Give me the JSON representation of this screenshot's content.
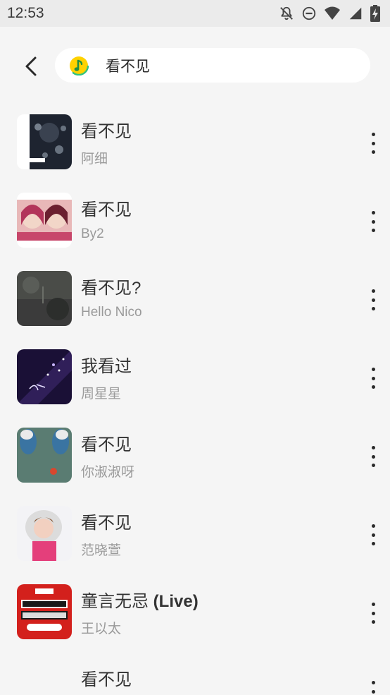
{
  "status_bar": {
    "time": "12:53",
    "icons": [
      "notifications-off-icon",
      "do-not-disturb-icon",
      "wifi-icon",
      "signal-icon",
      "battery-charging-icon"
    ]
  },
  "search": {
    "back_icon": "back-arrow-icon",
    "logo_icon": "qq-music-logo-icon",
    "query": "看不见"
  },
  "results": [
    {
      "title": "看不见",
      "artist": "阿细",
      "cover_colors": [
        "#1e2430",
        "#9aa6b4"
      ]
    },
    {
      "title": "看不见",
      "artist": "By2",
      "cover_colors": [
        "#c7466a",
        "#f2d6c8"
      ]
    },
    {
      "title": "看不见?",
      "artist": "Hello Nico",
      "cover_colors": [
        "#3b3b3b",
        "#6b6e68"
      ]
    },
    {
      "title": "我看过",
      "artist": "周星星",
      "cover_colors": [
        "#1a1036",
        "#5a3c8e"
      ]
    },
    {
      "title": "看不见",
      "artist": "你淑淑呀",
      "cover_colors": [
        "#3a74a2",
        "#6c8f6a"
      ]
    },
    {
      "title": "看不见",
      "artist": "范晓萱",
      "cover_colors": [
        "#e43f7b",
        "#f3f3f6"
      ]
    },
    {
      "title": "童言无忌 (Live)",
      "artist": "王以太",
      "cover_colors": [
        "#d3201c",
        "#ffffff"
      ]
    },
    {
      "title": "看不见",
      "artist": "",
      "cover_colors": [
        "#f5f5f5",
        "#f5f5f5"
      ]
    }
  ],
  "colors": {
    "background": "#f5f5f5",
    "status_bar": "#ebebeb",
    "title_text": "#333333",
    "artist_text": "#9a9a9a"
  }
}
